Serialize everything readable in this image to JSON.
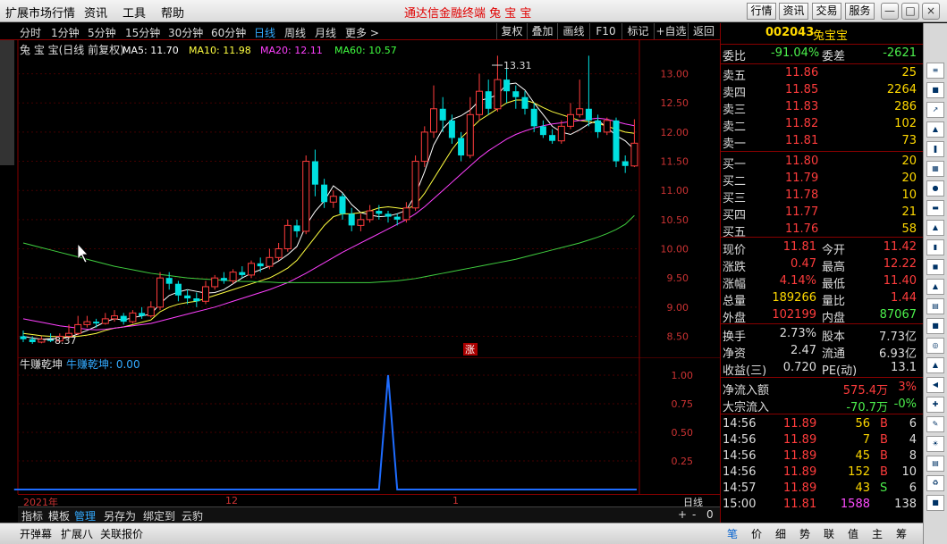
{
  "menu": {
    "items": [
      "扩展市场行情",
      "资讯",
      "工具",
      "帮助"
    ],
    "center": "通达信金融终端   兔 宝 宝",
    "right_buttons": [
      "行情",
      "资讯",
      "交易",
      "服务"
    ]
  },
  "period": {
    "items": [
      "分时",
      "1分钟",
      "5分钟",
      "15分钟",
      "30分钟",
      "60分钟",
      "日线",
      "周线",
      "月线",
      "更多 >"
    ],
    "active": "日线",
    "tools": [
      "复权",
      "叠加",
      "画线",
      "F10",
      "标记",
      "+自选",
      "返回"
    ]
  },
  "chart": {
    "title": "兔 宝 宝(日线 前复权)",
    "ma": [
      {
        "label": "MA5: 11.70",
        "color": "#ffffff"
      },
      {
        "label": "MA10: 11.98",
        "color": "#ffff40"
      },
      {
        "label": "MA20: 12.11",
        "color": "#ff40ff"
      },
      {
        "label": "MA60: 10.57",
        "color": "#40ff40"
      }
    ],
    "high_label": "13.31",
    "low_label": "8.37",
    "zhang": "涨",
    "ylim": [
      8.4,
      13.3
    ],
    "yticks": [
      "13.00",
      "12.50",
      "12.00",
      "11.50",
      "11.00",
      "10.50",
      "10.00",
      "9.50",
      "9.00",
      "8.50"
    ],
    "sub_title": "牛赚乾坤",
    "sub_value": "牛赚乾坤: 0.00",
    "sub_yticks": [
      "1.00",
      "0.75",
      "0.50",
      "0.25"
    ],
    "x_labels": [
      "2021年",
      "12",
      "1"
    ],
    "period_label": "日线",
    "nav": [
      "+",
      "-",
      "0"
    ]
  },
  "chart_data": {
    "type": "candlestick",
    "ylim": [
      8.4,
      13.3
    ],
    "candles": [
      [
        8.5,
        8.45,
        8.6,
        8.4
      ],
      [
        8.45,
        8.4,
        8.5,
        8.37
      ],
      [
        8.4,
        8.45,
        8.5,
        8.38
      ],
      [
        8.45,
        8.42,
        8.55,
        8.4
      ],
      [
        8.42,
        8.5,
        8.55,
        8.4
      ],
      [
        8.5,
        8.55,
        8.7,
        8.48
      ],
      [
        8.55,
        8.7,
        8.85,
        8.52
      ],
      [
        8.7,
        8.75,
        8.85,
        8.65
      ],
      [
        8.75,
        8.72,
        8.8,
        8.65
      ],
      [
        8.72,
        8.8,
        8.9,
        8.7
      ],
      [
        8.8,
        8.85,
        8.95,
        8.75
      ],
      [
        8.85,
        8.75,
        8.9,
        8.7
      ],
      [
        8.75,
        8.9,
        8.95,
        8.72
      ],
      [
        8.9,
        8.85,
        9.0,
        8.8
      ],
      [
        8.85,
        9.0,
        9.1,
        8.82
      ],
      [
        9.0,
        9.5,
        9.6,
        8.95
      ],
      [
        9.5,
        9.4,
        9.6,
        9.3
      ],
      [
        9.4,
        9.2,
        9.45,
        9.1
      ],
      [
        9.2,
        9.15,
        9.3,
        9.05
      ],
      [
        9.15,
        9.1,
        9.25,
        9.0
      ],
      [
        9.1,
        9.35,
        9.45,
        9.05
      ],
      [
        9.35,
        9.5,
        9.55,
        9.3
      ],
      [
        9.5,
        9.45,
        9.6,
        9.4
      ],
      [
        9.45,
        9.6,
        9.65,
        9.4
      ],
      [
        9.6,
        9.55,
        9.7,
        9.5
      ],
      [
        9.55,
        9.75,
        9.8,
        9.5
      ],
      [
        9.75,
        9.7,
        9.85,
        9.6
      ],
      [
        9.7,
        9.85,
        10.0,
        9.65
      ],
      [
        9.85,
        10.0,
        10.1,
        9.8
      ],
      [
        10.0,
        10.4,
        10.5,
        9.95
      ],
      [
        10.4,
        10.3,
        10.5,
        10.2
      ],
      [
        10.3,
        11.5,
        11.6,
        10.25
      ],
      [
        11.5,
        11.1,
        11.7,
        10.9
      ],
      [
        11.1,
        10.8,
        11.2,
        10.7
      ],
      [
        10.8,
        10.9,
        11.0,
        10.7
      ],
      [
        10.9,
        10.6,
        10.95,
        10.5
      ],
      [
        10.6,
        10.4,
        10.7,
        10.3
      ],
      [
        10.4,
        10.5,
        10.6,
        10.3
      ],
      [
        10.5,
        10.65,
        10.75,
        10.45
      ],
      [
        10.65,
        10.6,
        10.75,
        10.5
      ],
      [
        10.6,
        10.55,
        10.65,
        10.45
      ],
      [
        10.55,
        10.5,
        10.6,
        10.4
      ],
      [
        10.5,
        10.7,
        10.8,
        10.45
      ],
      [
        10.7,
        11.5,
        11.6,
        10.65
      ],
      [
        11.5,
        12.0,
        12.1,
        11.4
      ],
      [
        12.0,
        12.4,
        12.8,
        11.9
      ],
      [
        12.4,
        12.2,
        12.6,
        12.0
      ],
      [
        12.2,
        11.9,
        12.3,
        11.8
      ],
      [
        11.9,
        11.6,
        12.0,
        11.5
      ],
      [
        11.6,
        12.3,
        12.6,
        11.55
      ],
      [
        12.3,
        12.7,
        13.0,
        12.2
      ],
      [
        12.7,
        12.4,
        12.9,
        12.3
      ],
      [
        12.4,
        12.9,
        13.31,
        12.35
      ],
      [
        12.9,
        12.7,
        13.1,
        12.5
      ],
      [
        12.7,
        12.6,
        12.8,
        12.4
      ],
      [
        12.6,
        12.4,
        12.7,
        12.3
      ],
      [
        12.4,
        12.1,
        12.5,
        12.0
      ],
      [
        12.1,
        11.95,
        12.2,
        11.9
      ],
      [
        11.95,
        11.85,
        12.05,
        11.8
      ],
      [
        11.85,
        12.1,
        12.2,
        11.8
      ],
      [
        12.1,
        12.3,
        12.5,
        12.05
      ],
      [
        12.3,
        12.4,
        12.9,
        12.25
      ],
      [
        12.4,
        12.2,
        13.31,
        12.1
      ],
      [
        12.2,
        12.0,
        12.3,
        11.9
      ],
      [
        12.0,
        12.2,
        12.25,
        11.95
      ],
      [
        12.2,
        11.5,
        12.25,
        11.4
      ],
      [
        11.5,
        11.42,
        11.6,
        11.3
      ],
      [
        11.42,
        11.81,
        12.22,
        11.4
      ]
    ],
    "ma5": [
      8.5,
      8.47,
      8.45,
      8.46,
      8.46,
      8.48,
      8.54,
      8.6,
      8.67,
      8.75,
      8.8,
      8.78,
      8.82,
      8.85,
      8.88,
      9.06,
      9.2,
      9.26,
      9.3,
      9.27,
      9.24,
      9.25,
      9.3,
      9.4,
      9.5,
      9.58,
      9.64,
      9.7,
      9.79,
      9.9,
      10.04,
      10.4,
      10.64,
      10.82,
      11.08,
      10.96,
      10.76,
      10.62,
      10.58,
      10.55,
      10.56,
      10.6,
      10.66,
      10.93,
      11.32,
      11.78,
      12.06,
      12.22,
      12.28,
      12.38,
      12.54,
      12.58,
      12.64,
      12.82,
      12.84,
      12.72,
      12.5,
      12.3,
      12.1,
      12.0,
      11.96,
      12.04,
      12.14,
      12.2,
      12.08,
      11.94,
      11.85,
      11.7
    ],
    "ma10": [
      8.55,
      8.53,
      8.51,
      8.5,
      8.49,
      8.49,
      8.5,
      8.52,
      8.55,
      8.6,
      8.64,
      8.66,
      8.7,
      8.74,
      8.78,
      8.92,
      9.0,
      9.05,
      9.08,
      9.1,
      9.15,
      9.2,
      9.25,
      9.3,
      9.35,
      9.4,
      9.45,
      9.5,
      9.58,
      9.67,
      9.8,
      10.0,
      10.2,
      10.4,
      10.55,
      10.6,
      10.6,
      10.62,
      10.65,
      10.7,
      10.72,
      10.7,
      10.68,
      10.75,
      10.95,
      11.2,
      11.45,
      11.7,
      11.9,
      12.05,
      12.2,
      12.3,
      12.4,
      12.5,
      12.55,
      12.55,
      12.5,
      12.42,
      12.35,
      12.3,
      12.25,
      12.2,
      12.18,
      12.15,
      12.1,
      12.05,
      12.0,
      11.98
    ],
    "ma20": [
      8.8,
      8.77,
      8.74,
      8.71,
      8.68,
      8.66,
      8.64,
      8.62,
      8.61,
      8.62,
      8.64,
      8.66,
      8.68,
      8.7,
      8.72,
      8.76,
      8.8,
      8.84,
      8.88,
      8.92,
      8.96,
      9.0,
      9.05,
      9.1,
      9.15,
      9.2,
      9.25,
      9.3,
      9.36,
      9.42,
      9.5,
      9.58,
      9.67,
      9.76,
      9.85,
      9.94,
      10.02,
      10.1,
      10.18,
      10.26,
      10.34,
      10.42,
      10.5,
      10.6,
      10.72,
      10.86,
      11.0,
      11.14,
      11.28,
      11.42,
      11.56,
      11.68,
      11.78,
      11.88,
      11.96,
      12.02,
      12.07,
      12.11,
      12.14,
      12.16,
      12.18,
      12.2,
      12.22,
      12.24,
      12.22,
      12.18,
      12.14,
      12.11
    ],
    "ma60": [
      10.1,
      10.06,
      10.02,
      9.98,
      9.94,
      9.9,
      9.86,
      9.82,
      9.78,
      9.74,
      9.7,
      9.67,
      9.64,
      9.61,
      9.58,
      9.56,
      9.54,
      9.52,
      9.5,
      9.49,
      9.48,
      9.47,
      9.46,
      9.45,
      9.44,
      9.44,
      9.43,
      9.43,
      9.42,
      9.42,
      9.42,
      9.42,
      9.42,
      9.42,
      9.42,
      9.42,
      9.42,
      9.42,
      9.42,
      9.43,
      9.44,
      9.45,
      9.47,
      9.49,
      9.52,
      9.55,
      9.58,
      9.61,
      9.64,
      9.67,
      9.7,
      9.73,
      9.76,
      9.79,
      9.82,
      9.86,
      9.9,
      9.94,
      9.98,
      10.02,
      10.06,
      10.1,
      10.15,
      10.2,
      10.26,
      10.33,
      10.42,
      10.57
    ],
    "indicator": {
      "name": "牛赚乾坤",
      "ylim": [
        0,
        1
      ],
      "values": [
        0,
        0,
        0,
        0,
        0,
        0,
        0,
        0,
        0,
        0,
        0,
        0,
        0,
        0,
        0,
        0,
        0,
        0,
        0,
        0,
        0,
        0,
        0,
        0,
        0,
        0,
        0,
        0,
        0,
        0,
        0,
        0,
        0,
        0,
        0,
        0,
        0,
        0,
        0,
        0,
        1,
        0,
        0,
        0,
        0,
        0,
        0,
        0,
        0,
        0,
        0,
        0,
        0,
        0,
        0,
        0,
        0,
        0,
        0,
        0,
        0,
        0,
        0,
        0,
        0,
        0,
        0,
        0
      ]
    }
  },
  "bottom_tabs": {
    "items": [
      "指标",
      "模板",
      "管理",
      "另存为",
      "绑定到",
      "云豹"
    ],
    "active": "管理"
  },
  "statusbar": {
    "items": [
      "开弹幕",
      "扩展八",
      "关联报价"
    ]
  },
  "quote": {
    "code": "002043",
    "name": "兔宝宝",
    "weibi_label": "委比",
    "weibi": "-91.04%",
    "weicha_label": "委差",
    "weicha": "-2621",
    "sells": [
      {
        "label": "卖五",
        "price": "11.86",
        "vol": "25"
      },
      {
        "label": "卖四",
        "price": "11.85",
        "vol": "2264"
      },
      {
        "label": "卖三",
        "price": "11.83",
        "vol": "286"
      },
      {
        "label": "卖二",
        "price": "11.82",
        "vol": "102"
      },
      {
        "label": "卖一",
        "price": "11.81",
        "vol": "73"
      }
    ],
    "buys": [
      {
        "label": "买一",
        "price": "11.80",
        "vol": "20"
      },
      {
        "label": "买二",
        "price": "11.79",
        "vol": "20"
      },
      {
        "label": "买三",
        "price": "11.78",
        "vol": "10"
      },
      {
        "label": "买四",
        "price": "11.77",
        "vol": "21"
      },
      {
        "label": "买五",
        "price": "11.76",
        "vol": "58"
      }
    ],
    "stats": [
      {
        "l1": "现价",
        "v1": "11.81",
        "l2": "今开",
        "v2": "11.42",
        "c1": "red",
        "c2": "red"
      },
      {
        "l1": "涨跌",
        "v1": "0.47",
        "l2": "最高",
        "v2": "12.22",
        "c1": "red",
        "c2": "red"
      },
      {
        "l1": "涨幅",
        "v1": "4.14%",
        "l2": "最低",
        "v2": "11.40",
        "c1": "red",
        "c2": "red"
      },
      {
        "l1": "总量",
        "v1": "189266",
        "l2": "量比",
        "v2": "1.44",
        "c1": "yel",
        "c2": "red"
      },
      {
        "l1": "外盘",
        "v1": "102199",
        "l2": "内盘",
        "v2": "87067",
        "c1": "red",
        "c2": "grn"
      }
    ],
    "stats2": [
      {
        "l1": "换手",
        "v1": "2.73%",
        "l2": "股本",
        "v2": "7.73亿"
      },
      {
        "l1": "净资",
        "v1": "2.47",
        "l2": "流通",
        "v2": "6.93亿"
      },
      {
        "l1": "收益(三)",
        "v1": "0.720",
        "l2": "PE(动)",
        "v2": "13.1"
      }
    ],
    "flow": [
      {
        "label": "净流入额",
        "value": "575.4万",
        "pct": "3%",
        "c": "red"
      },
      {
        "label": "大宗流入",
        "value": "-70.7万",
        "pct": "-0%",
        "c": "grn"
      }
    ],
    "ticks": [
      {
        "time": "14:56",
        "price": "11.89",
        "vol": "56",
        "bs": "B",
        "n": "6"
      },
      {
        "time": "14:56",
        "price": "11.89",
        "vol": "7",
        "bs": "B",
        "n": "4"
      },
      {
        "time": "14:56",
        "price": "11.89",
        "vol": "45",
        "bs": "B",
        "n": "8"
      },
      {
        "time": "14:56",
        "price": "11.89",
        "vol": "152",
        "bs": "B",
        "n": "10"
      },
      {
        "time": "14:57",
        "price": "11.89",
        "vol": "43",
        "bs": "S",
        "n": "6"
      },
      {
        "time": "15:00",
        "price": "11.81",
        "vol": "1588",
        "bs": "",
        "n": "138"
      }
    ],
    "bottom_tabs": [
      "笔",
      "价",
      "细",
      "势",
      "联",
      "值",
      "主",
      "筹"
    ]
  }
}
